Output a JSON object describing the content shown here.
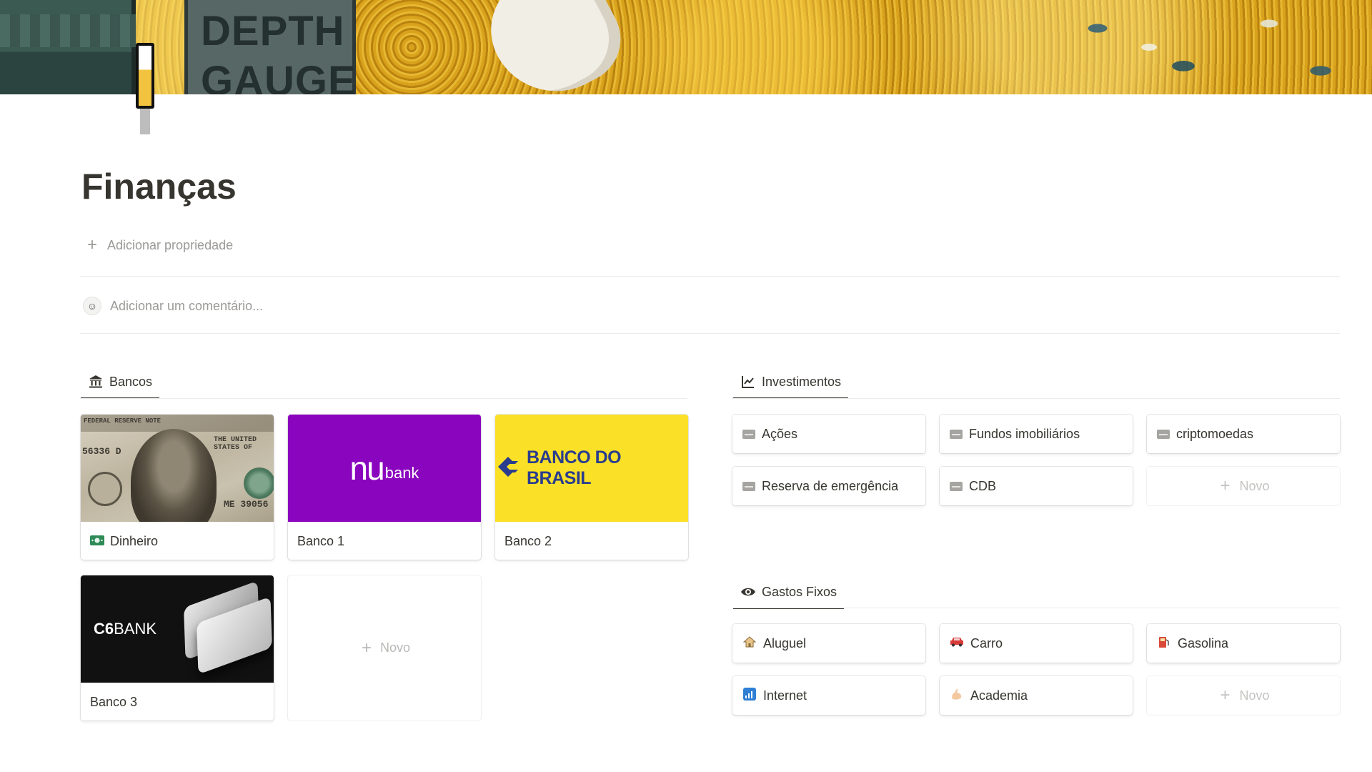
{
  "cover": {
    "gauge_line1": "DEPTH",
    "gauge_line2": "GAUGE"
  },
  "page": {
    "title": "Finanças",
    "add_property": "Adicionar propriedade",
    "comment_placeholder": "Adicionar um comentário..."
  },
  "bancos": {
    "tab_label": "Bancos",
    "cards": [
      {
        "label": "Dinheiro",
        "serial_top": "56336 D",
        "serial_bottom": "ME 39056",
        "top_text": "FEDERAL RESERVE NOTE",
        "side_text": "THE UNITED STATES OF"
      },
      {
        "label": "Banco 1",
        "logo_main": "nu",
        "logo_sub": "bank"
      },
      {
        "label": "Banco 2",
        "logo_text": "BANCO DO BRASIL"
      },
      {
        "label": "Banco 3",
        "logo_bold": "C6",
        "logo_light": "BANK"
      }
    ],
    "new_label": "Novo"
  },
  "investimentos": {
    "tab_label": "Investimentos",
    "items": [
      "Ações",
      "Fundos imobiliários",
      "criptomoedas",
      "Reserva de emergência",
      "CDB"
    ],
    "new_label": "Novo"
  },
  "gastos_fixos": {
    "tab_label": "Gastos Fixos",
    "items": [
      {
        "label": "Aluguel",
        "icon": "house-icon"
      },
      {
        "label": "Carro",
        "icon": "car-icon"
      },
      {
        "label": "Gasolina",
        "icon": "fuel-pump-icon"
      },
      {
        "label": "Internet",
        "icon": "signal-bars-icon"
      },
      {
        "label": "Academia",
        "icon": "flexed-arm-icon"
      }
    ],
    "new_label": "Novo"
  },
  "colors": {
    "nubank": "#8a05be",
    "banco_do_brasil_yellow": "#fae128",
    "banco_do_brasil_blue": "#2a3c8e",
    "text": "#37352f",
    "muted": "#9b9a97"
  }
}
